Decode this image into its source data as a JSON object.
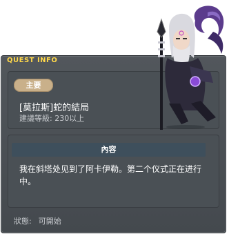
{
  "quest": {
    "id": "34268-0",
    "header": "QUEST INFO",
    "tag": "主要",
    "name": "[莫拉斯]蛇的結局",
    "level": "建議等級: 230以上",
    "content_label": "內容",
    "description": "我在斜塔处见到了阿卡伊勒。第二个仪式正在进行中。",
    "status_label": "狀態:",
    "status_value": "可開始"
  },
  "colors": {
    "title_yellow": "#ffd84a",
    "panel": "#4a5055",
    "tag": "#c9b08a",
    "content_header": "#3e4f5c"
  },
  "icons": {
    "npc": "akairum-npc-illustration"
  }
}
